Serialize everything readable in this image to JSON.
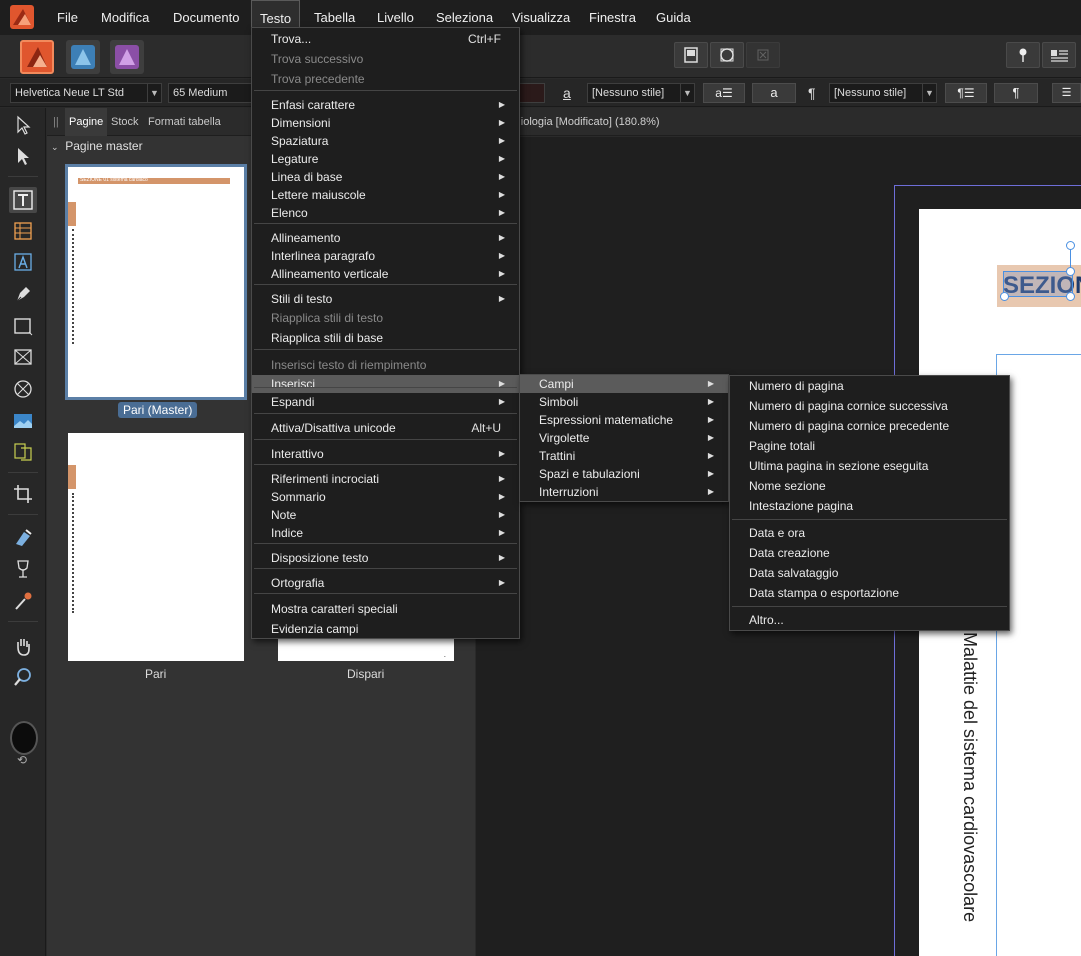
{
  "menubar": {
    "items": [
      "File",
      "Modifica",
      "Documento",
      "Testo",
      "Tabella",
      "Livello",
      "Seleziona",
      "Visualizza",
      "Finestra",
      "Guida"
    ],
    "active": "Testo"
  },
  "context": {
    "font": "Helvetica Neue LT Std",
    "weight": "65 Medium",
    "char_style": "[Nessuno stile]",
    "para_style": "[Nessuno stile]",
    "char_btn": "a",
    "para_btn": "¶"
  },
  "panel": {
    "tabs": [
      "Pagine",
      "Stock",
      "Formati tabella"
    ],
    "section": "Pagine master",
    "thumb_header_text": "SEZIONE 01 sistema cardiaco",
    "labels": {
      "master": "Pari (Master)",
      "pari": "Pari",
      "dispari": "Dispari"
    }
  },
  "document": {
    "title": "rdiologia [Modificato] (180.8%)",
    "heading": "SEZIONE",
    "vertical_text": "Malattie del sistema cardiovascolare"
  },
  "testo_menu": [
    {
      "label": "Trova...",
      "shortcut": "Ctrl+F"
    },
    {
      "label": "Trova successivo",
      "disabled": true
    },
    {
      "label": "Trova precedente",
      "disabled": true
    },
    {
      "label": "Enfasi carattere",
      "sub": true
    },
    {
      "label": "Dimensioni",
      "sub": true
    },
    {
      "label": "Spaziatura",
      "sub": true
    },
    {
      "label": "Legature",
      "sub": true
    },
    {
      "label": "Linea di base",
      "sub": true
    },
    {
      "label": "Lettere maiuscole",
      "sub": true
    },
    {
      "label": "Elenco",
      "sub": true
    },
    {
      "label": "Allineamento",
      "sub": true
    },
    {
      "label": "Interlinea paragrafo",
      "sub": true
    },
    {
      "label": "Allineamento verticale",
      "sub": true
    },
    {
      "label": "Stili di testo",
      "sub": true
    },
    {
      "label": "Riapplica stili di testo",
      "disabled": true
    },
    {
      "label": "Riapplica stili di base"
    },
    {
      "label": "Inserisci testo di riempimento",
      "disabled": true
    },
    {
      "label": "Inserisci",
      "sub": true
    },
    {
      "label": "Espandi",
      "sub": true
    },
    {
      "label": "Attiva/Disattiva unicode",
      "shortcut": "Alt+U"
    },
    {
      "label": "Interattivo",
      "sub": true
    },
    {
      "label": "Riferimenti incrociati",
      "sub": true
    },
    {
      "label": "Sommario",
      "sub": true
    },
    {
      "label": "Note",
      "sub": true
    },
    {
      "label": "Indice",
      "sub": true
    },
    {
      "label": "Disposizione testo",
      "sub": true
    },
    {
      "label": "Ortografia",
      "sub": true
    },
    {
      "label": "Mostra caratteri speciali"
    },
    {
      "label": "Evidenzia campi"
    }
  ],
  "inserisci_menu": [
    "Campi",
    "Simboli",
    "Espressioni matematiche",
    "Virgolette",
    "Trattini",
    "Spazi e tabulazioni",
    "Interruzioni"
  ],
  "campi_menu": [
    "Numero di pagina",
    "Numero di pagina cornice successiva",
    "Numero di pagina cornice precedente",
    "Pagine totali",
    "Ultima pagina in sezione eseguita",
    "Nome sezione",
    "Intestazione pagina",
    "Data e ora",
    "Data creazione",
    "Data salvataggio",
    "Data stampa o esportazione",
    "Altro..."
  ],
  "submenu_arrow": "▶",
  "colors": {
    "accent": "#5b7fa6",
    "highlight": "#5b5b5b",
    "header_orange": "#d4956a"
  }
}
